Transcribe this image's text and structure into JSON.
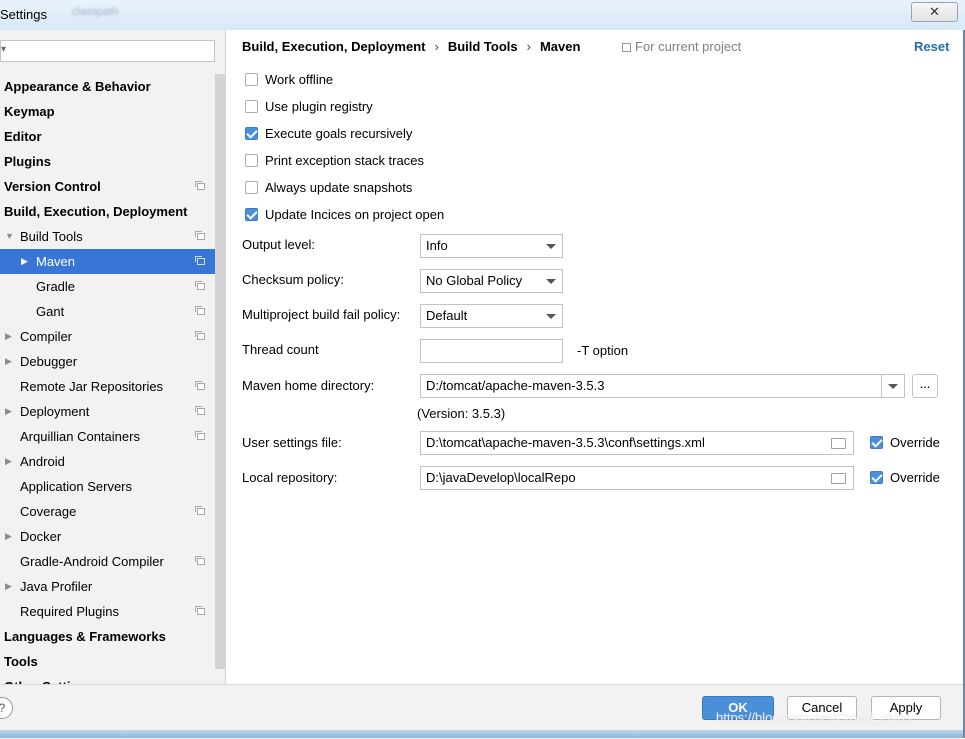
{
  "window": {
    "title": "Settings",
    "blurred_app": "classpath",
    "close_symbol": "✕"
  },
  "search": {
    "placeholder": "",
    "icon": "search-icon"
  },
  "tree": [
    {
      "label": "Appearance & Behavior",
      "bold": true,
      "indent": 0,
      "arrow": "",
      "project": false
    },
    {
      "label": "Keymap",
      "bold": true,
      "indent": 0,
      "arrow": "",
      "project": false
    },
    {
      "label": "Editor",
      "bold": true,
      "indent": 0,
      "arrow": "",
      "project": false
    },
    {
      "label": "Plugins",
      "bold": true,
      "indent": 0,
      "arrow": "",
      "project": false
    },
    {
      "label": "Version Control",
      "bold": true,
      "indent": 0,
      "arrow": "",
      "project": true
    },
    {
      "label": "Build, Execution, Deployment",
      "bold": true,
      "indent": 0,
      "arrow": "",
      "project": false
    },
    {
      "label": "Build Tools",
      "bold": false,
      "indent": 1,
      "arrow": "down",
      "project": true
    },
    {
      "label": "Maven",
      "bold": false,
      "indent": 2,
      "arrow": "right",
      "project": true,
      "selected": true
    },
    {
      "label": "Gradle",
      "bold": false,
      "indent": 2,
      "arrow": "",
      "project": true
    },
    {
      "label": "Gant",
      "bold": false,
      "indent": 2,
      "arrow": "",
      "project": true
    },
    {
      "label": "Compiler",
      "bold": false,
      "indent": 1,
      "arrow": "right",
      "project": true
    },
    {
      "label": "Debugger",
      "bold": false,
      "indent": 1,
      "arrow": "right",
      "project": false
    },
    {
      "label": "Remote Jar Repositories",
      "bold": false,
      "indent": 1,
      "arrow": "",
      "project": true
    },
    {
      "label": "Deployment",
      "bold": false,
      "indent": 1,
      "arrow": "right",
      "project": true
    },
    {
      "label": "Arquillian Containers",
      "bold": false,
      "indent": 1,
      "arrow": "",
      "project": true
    },
    {
      "label": "Android",
      "bold": false,
      "indent": 1,
      "arrow": "right",
      "project": false
    },
    {
      "label": "Application Servers",
      "bold": false,
      "indent": 1,
      "arrow": "",
      "project": false
    },
    {
      "label": "Coverage",
      "bold": false,
      "indent": 1,
      "arrow": "",
      "project": true
    },
    {
      "label": "Docker",
      "bold": false,
      "indent": 1,
      "arrow": "right",
      "project": false
    },
    {
      "label": "Gradle-Android Compiler",
      "bold": false,
      "indent": 1,
      "arrow": "",
      "project": true
    },
    {
      "label": "Java Profiler",
      "bold": false,
      "indent": 1,
      "arrow": "right",
      "project": false
    },
    {
      "label": "Required Plugins",
      "bold": false,
      "indent": 1,
      "arrow": "",
      "project": true
    },
    {
      "label": "Languages & Frameworks",
      "bold": true,
      "indent": 0,
      "arrow": "",
      "project": false
    },
    {
      "label": "Tools",
      "bold": true,
      "indent": 0,
      "arrow": "",
      "project": false
    },
    {
      "label": "Other Settings",
      "bold": true,
      "indent": 0,
      "arrow": "",
      "project": false
    }
  ],
  "breadcrumb": {
    "part1": "Build, Execution, Deployment",
    "part2": "Build Tools",
    "part3": "Maven",
    "separator": "›",
    "for_project": "For current project",
    "reset": "Reset"
  },
  "checkboxes": [
    {
      "label": "Work offline",
      "checked": false
    },
    {
      "label": "Use plugin registry",
      "checked": false
    },
    {
      "label": "Execute goals recursively",
      "checked": true
    },
    {
      "label": "Print exception stack traces",
      "checked": false
    },
    {
      "label": "Always update snapshots",
      "checked": false
    },
    {
      "label": "Update Incices on project open",
      "checked": true
    }
  ],
  "form": {
    "output_level_label": "Output level:",
    "output_level_value": "Info",
    "checksum_label": "Checksum policy:",
    "checksum_value": "No Global Policy",
    "multiproject_label": "Multiproject build fail policy:",
    "multiproject_value": "Default",
    "thread_label": "Thread count",
    "thread_value": "",
    "thread_hint": "-T option",
    "maven_home_label": "Maven home directory:",
    "maven_home_value": "D:/tomcat/apache-maven-3.5.3",
    "browse_label": "...",
    "version_text": "(Version: 3.5.3)",
    "user_settings_label": "User settings file:",
    "user_settings_value": "D:\\tomcat\\apache-maven-3.5.3\\conf\\settings.xml",
    "user_override_label": "Override",
    "user_override_checked": true,
    "local_repo_label": "Local repository:",
    "local_repo_value": "D:\\javaDevelop\\localRepo",
    "local_override_label": "Override",
    "local_override_checked": true
  },
  "footer": {
    "help": "?",
    "ok": "OK",
    "cancel": "Cancel",
    "apply": "Apply",
    "watermark": "https://blog.csdn.net/Crowd_chips"
  },
  "colors": {
    "selection": "#3875d7",
    "link": "#2470b3",
    "primary_button": "#4a90d9"
  }
}
